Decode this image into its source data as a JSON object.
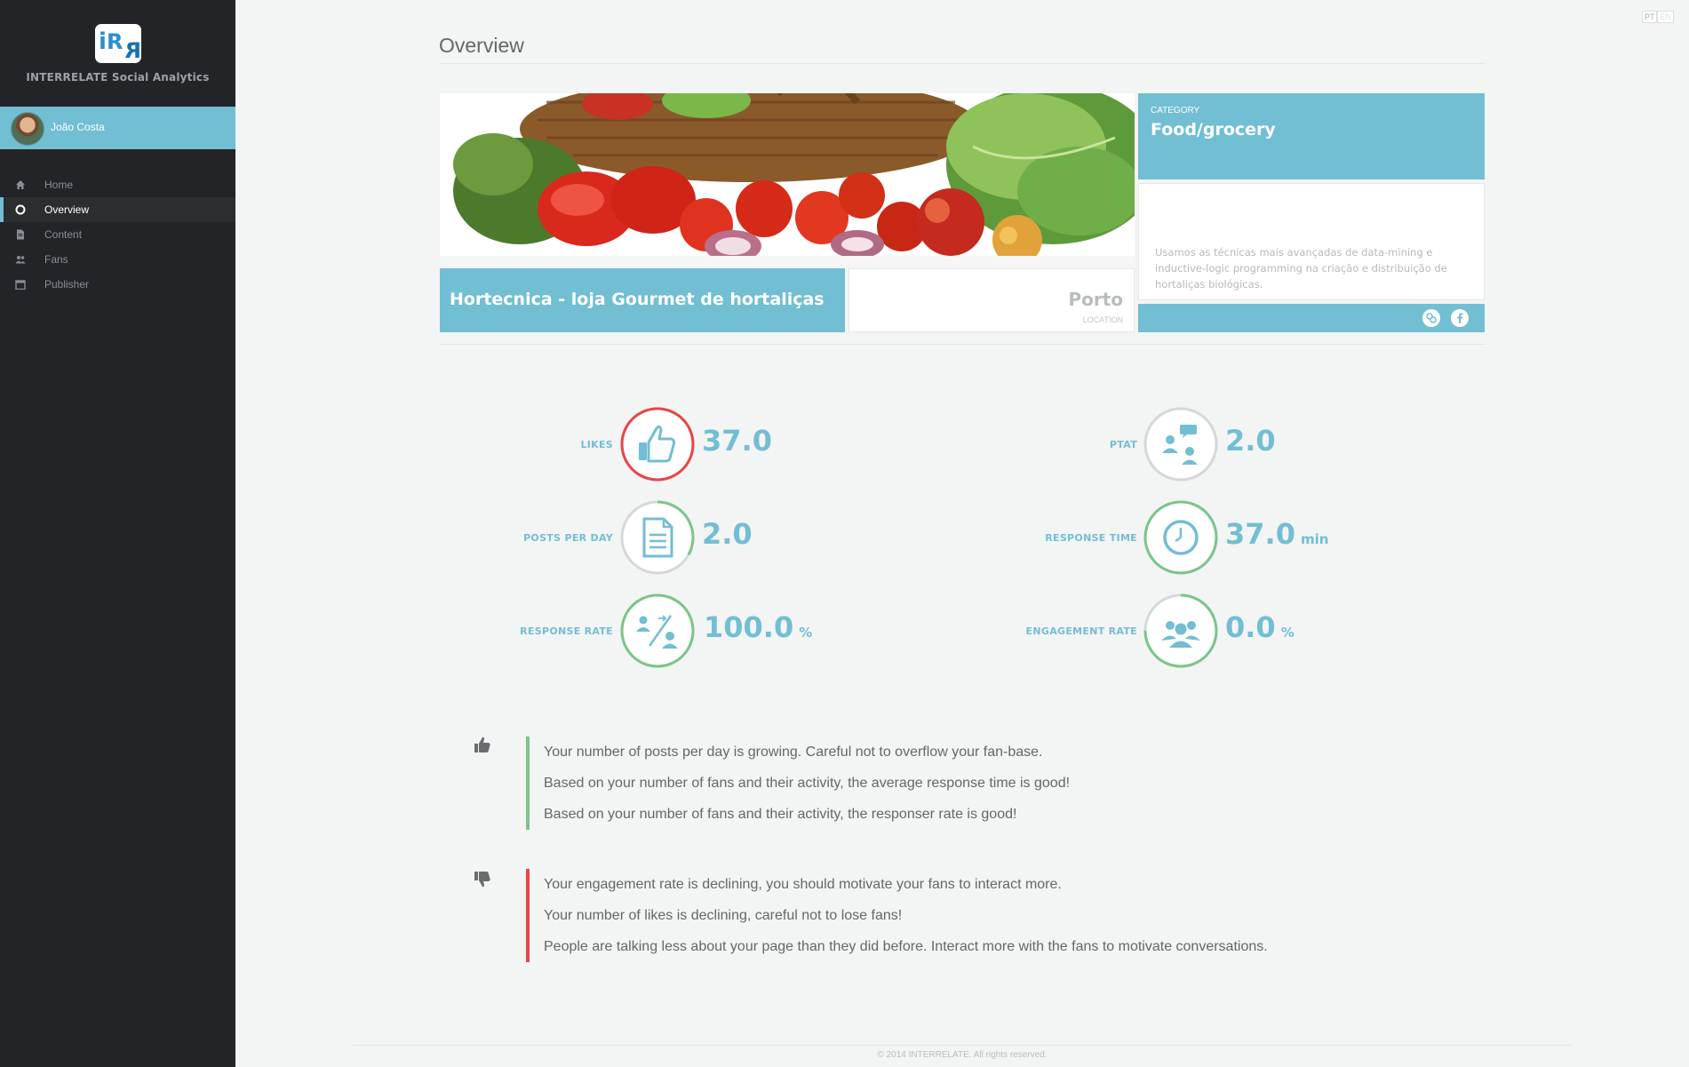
{
  "app": {
    "brand": "INTERRELATE Social Analytics",
    "logo_text": "iRR"
  },
  "user": {
    "name": "João Costa"
  },
  "nav": [
    {
      "label": "Home",
      "icon": "home-icon"
    },
    {
      "label": "Overview",
      "icon": "circle-icon",
      "active": true
    },
    {
      "label": "Content",
      "icon": "document-icon"
    },
    {
      "label": "Fans",
      "icon": "users-icon"
    },
    {
      "label": "Publisher",
      "icon": "calendar-icon"
    }
  ],
  "language": {
    "pt": "PT",
    "en": "EN",
    "active": "PT"
  },
  "page": {
    "title": "Overview"
  },
  "profile": {
    "name": "Hortecnica - loja Gourmet de hortaliças",
    "location_value": "Porto",
    "location_label": "LOCATION",
    "category_label": "CATEGORY",
    "category_value": "Food/grocery",
    "description": "Usamos as técnicas mais avançadas de data-mining e inductive-logic programming na criação e distribuição de hortaliças biológicas.",
    "social": [
      "link-icon",
      "facebook-icon"
    ]
  },
  "metrics": {
    "likes": {
      "label": "LIKES",
      "value": "37.0",
      "unit": "",
      "ring_color": "#e84646",
      "ring_fraction": 1.0,
      "icon": "thumbs-up-icon"
    },
    "posts_per_day": {
      "label": "POSTS PER DAY",
      "value": "2.0",
      "unit": "",
      "ring_color": "#7cc58a",
      "ring_fraction": 0.33,
      "icon": "document-icon"
    },
    "response_rate": {
      "label": "RESPONSE RATE",
      "value": "100.0",
      "unit": "%",
      "ring_color": "#7cc58a",
      "ring_fraction": 1.0,
      "icon": "response-rate-icon"
    },
    "ptat": {
      "label": "PTAT",
      "value": "2.0",
      "unit": "",
      "ring_color": "#cfd2d4",
      "ring_fraction": 0.0,
      "icon": "talking-people-icon"
    },
    "response_time": {
      "label": "RESPONSE TIME",
      "value": "37.0",
      "unit": "min",
      "ring_color": "#7cc58a",
      "ring_fraction": 1.0,
      "icon": "clock-icon"
    },
    "engagement_rate": {
      "label": "ENGAGEMENT RATE",
      "value": "0.0",
      "unit": "%",
      "ring_color": "#7cc58a",
      "ring_fraction": 0.75,
      "icon": "group-icon"
    }
  },
  "insights": {
    "positive": [
      "Your number of posts per day is growing. Careful not to overflow your fan-base.",
      "Based on your number of fans and their activity, the average response time is good!",
      "Based on your number of fans and their activity, the responser rate is good!"
    ],
    "negative": [
      "Your engagement rate is declining, you should motivate your fans to interact more.",
      "Your number of likes is declining, careful not to lose fans!",
      "People are talking less about your page than they did before. Interact more with the fans to motivate conversations."
    ]
  },
  "footer": {
    "text": "© 2014 INTERRELATE. All rights reserved."
  },
  "colors": {
    "accent": "#72bed3",
    "sidebar": "#222427",
    "good": "#7cc58a",
    "bad": "#e84646"
  }
}
